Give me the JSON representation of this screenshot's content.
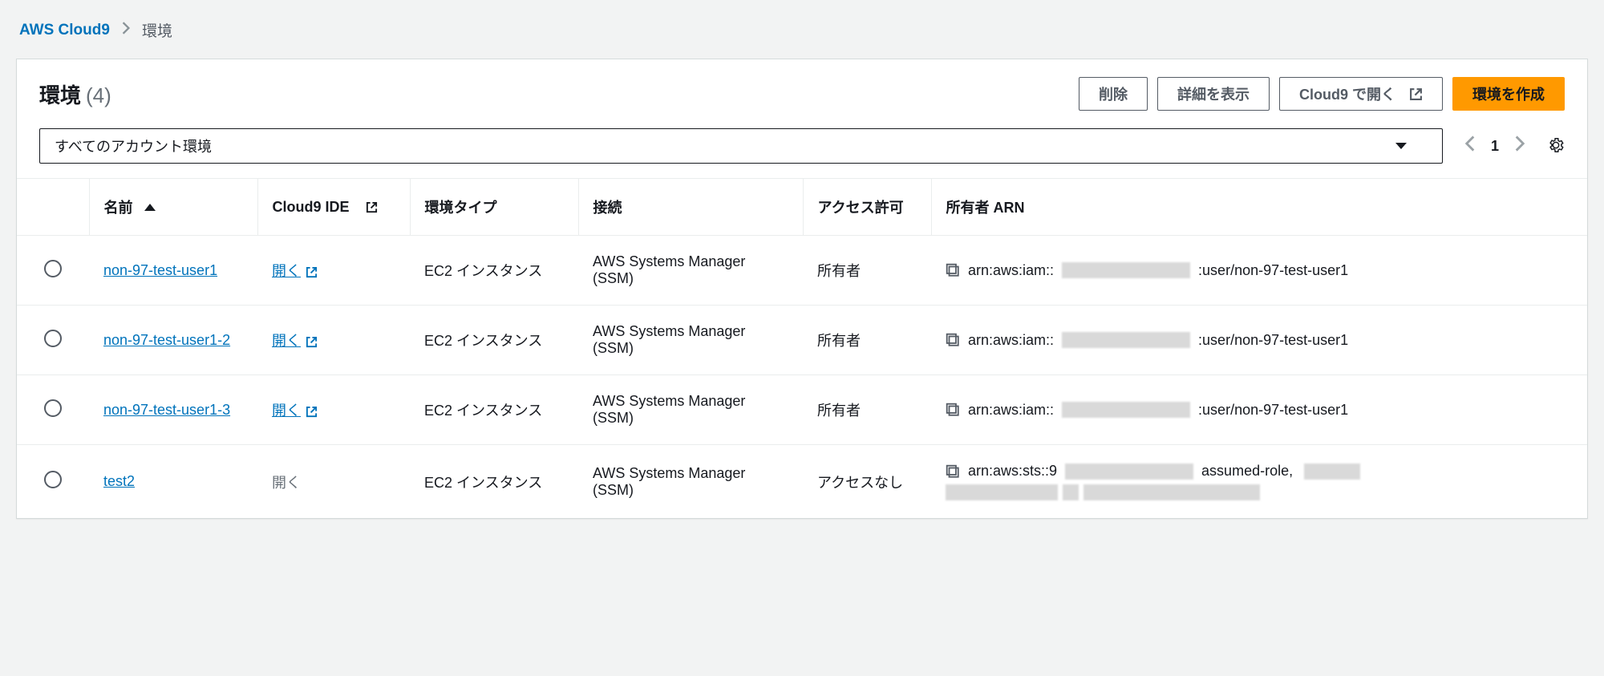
{
  "breadcrumb": {
    "service": "AWS Cloud9",
    "current": "環境"
  },
  "header": {
    "title": "環境",
    "count": "(4)",
    "delete": "削除",
    "details": "詳細を表示",
    "open_in_cloud9": "Cloud9 で開く",
    "create": "環境を作成"
  },
  "filter": {
    "selected": "すべてのアカウント環境"
  },
  "pager": {
    "page": "1"
  },
  "columns": {
    "name": "名前",
    "ide": "Cloud9 IDE",
    "type": "環境タイプ",
    "connection": "接続",
    "permission": "アクセス許可",
    "owner_arn": "所有者 ARN"
  },
  "ide_open_label": "開く",
  "rows": [
    {
      "name": "non-97-test-user1",
      "ide_enabled": true,
      "type": "EC2 インスタンス",
      "connection": "AWS Systems Manager (SSM)",
      "permission": "所有者",
      "arn_prefix": "arn:aws:iam::",
      "arn_suffix": ":user/non-97-test-user1"
    },
    {
      "name": "non-97-test-user1-2",
      "ide_enabled": true,
      "type": "EC2 インスタンス",
      "connection": "AWS Systems Manager (SSM)",
      "permission": "所有者",
      "arn_prefix": "arn:aws:iam::",
      "arn_suffix": ":user/non-97-test-user1"
    },
    {
      "name": "non-97-test-user1-3",
      "ide_enabled": true,
      "type": "EC2 インスタンス",
      "connection": "AWS Systems Manager (SSM)",
      "permission": "所有者",
      "arn_prefix": "arn:aws:iam::",
      "arn_suffix": ":user/non-97-test-user1"
    },
    {
      "name": "test2",
      "ide_enabled": false,
      "type": "EC2 インスタンス",
      "connection": "AWS Systems Manager (SSM)",
      "permission": "アクセスなし",
      "arn_prefix": "arn:aws:sts::9",
      "arn_suffix": "assumed-role,"
    }
  ]
}
